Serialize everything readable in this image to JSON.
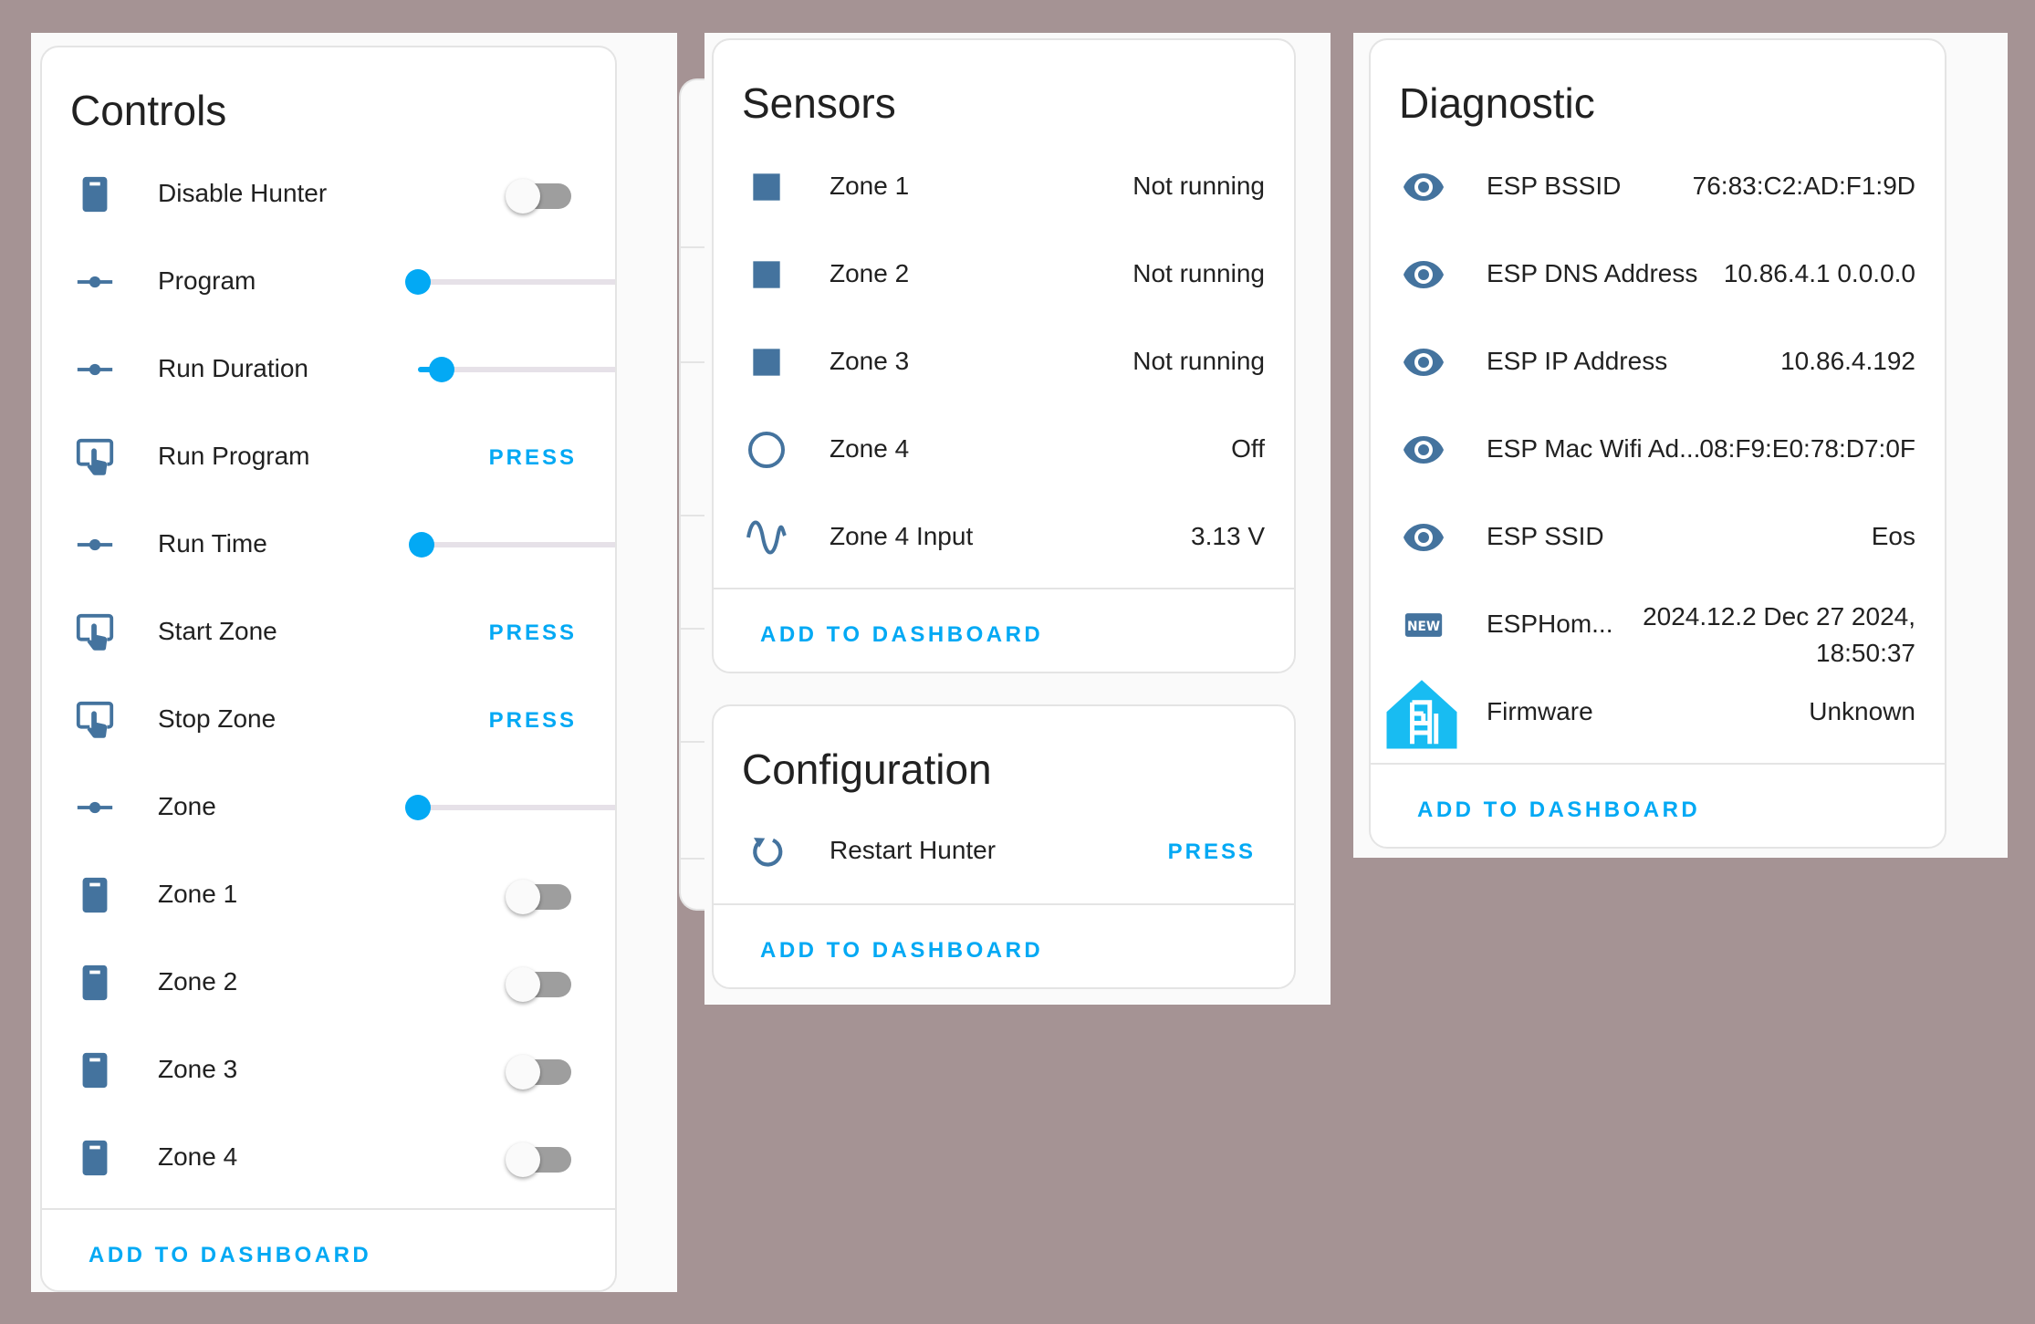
{
  "controls": {
    "title": "Controls",
    "items": [
      {
        "label": "Disable Hunter",
        "icon": "door-icon",
        "kind": "toggle",
        "on": false
      },
      {
        "label": "Program",
        "icon": "ray-vertex-icon",
        "kind": "slider",
        "level": 0
      },
      {
        "label": "Run Duration",
        "icon": "ray-vertex-icon",
        "kind": "slider",
        "level": 0.12
      },
      {
        "label": "Run Program",
        "icon": "gesture-tap-button-icon",
        "kind": "button",
        "action": "PRESS"
      },
      {
        "label": "Run Time",
        "icon": "ray-vertex-icon",
        "kind": "slider",
        "level": 0.02
      },
      {
        "label": "Start Zone",
        "icon": "gesture-tap-button-icon",
        "kind": "button",
        "action": "PRESS"
      },
      {
        "label": "Stop Zone",
        "icon": "gesture-tap-button-icon",
        "kind": "button",
        "action": "PRESS"
      },
      {
        "label": "Zone",
        "icon": "ray-vertex-icon",
        "kind": "slider",
        "level": 0
      },
      {
        "label": "Zone 1",
        "icon": "door-icon",
        "kind": "toggle",
        "on": false
      },
      {
        "label": "Zone 2",
        "icon": "door-icon",
        "kind": "toggle",
        "on": false
      },
      {
        "label": "Zone 3",
        "icon": "door-icon",
        "kind": "toggle",
        "on": false
      },
      {
        "label": "Zone 4",
        "icon": "door-icon",
        "kind": "toggle",
        "on": false
      }
    ],
    "add_label": "ADD TO DASHBOARD"
  },
  "sensors": {
    "title": "Sensors",
    "items": [
      {
        "label": "Zone 1",
        "value": "Not running",
        "icon": "square-icon"
      },
      {
        "label": "Zone 2",
        "value": "Not running",
        "icon": "square-icon"
      },
      {
        "label": "Zone 3",
        "value": "Not running",
        "icon": "square-icon"
      },
      {
        "label": "Zone 4",
        "value": "Off",
        "icon": "circle-outline-icon"
      },
      {
        "label": "Zone 4 Input",
        "value": "3.13 V",
        "icon": "sine-wave-icon"
      }
    ],
    "add_label": "ADD TO DASHBOARD"
  },
  "configuration": {
    "title": "Configuration",
    "items": [
      {
        "label": "Restart Hunter",
        "action": "PRESS",
        "icon": "restart-icon"
      }
    ],
    "add_label": "ADD TO DASHBOARD"
  },
  "diagnostic": {
    "title": "Diagnostic",
    "items": [
      {
        "label": "ESP BSSID",
        "value": "76:83:C2:AD:F1:9D",
        "icon": "eye-icon"
      },
      {
        "label": "ESP DNS Address",
        "value": "10.86.4.1 0.0.0.0",
        "icon": "eye-icon"
      },
      {
        "label": "ESP IP Address",
        "value": "10.86.4.192",
        "icon": "eye-icon"
      },
      {
        "label": "ESP Mac Wifi Ad...",
        "value": "08:F9:E0:78:D7:0F",
        "icon": "eye-icon"
      },
      {
        "label": "ESP SSID",
        "value": "Eos",
        "icon": "eye-icon"
      },
      {
        "label": "ESPHom...",
        "value_line1": "2024.12.2 Dec 27 2024,",
        "value_line2": "18:50:37",
        "icon": "new-box-icon"
      },
      {
        "label": "Firmware",
        "value": "Unknown",
        "icon": "home-assistant-logo-icon"
      }
    ],
    "add_label": "ADD TO DASHBOARD"
  },
  "colors": {
    "icon": "#44739e",
    "accent": "#03a9f4",
    "background": "#a59394",
    "toggle_off": "#9e9e9e"
  }
}
